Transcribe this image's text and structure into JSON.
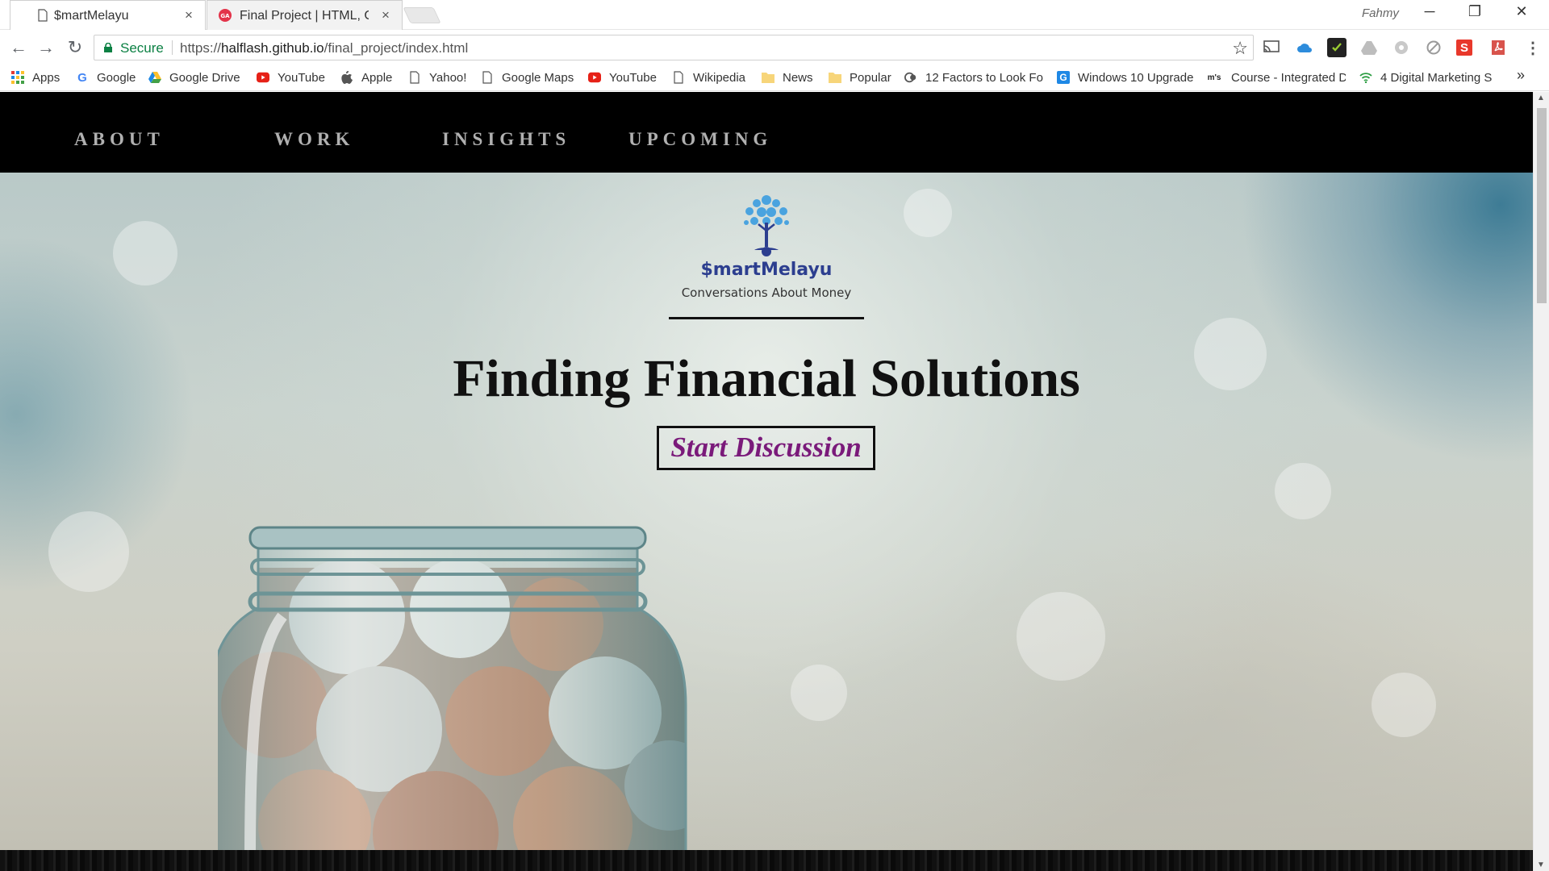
{
  "browser": {
    "tabs": [
      {
        "title": "$martMelayu",
        "close": "×",
        "active": true
      },
      {
        "title": "Final Project | HTML, CSS",
        "close": "×",
        "active": false
      }
    ],
    "profile_name": "Fahmy",
    "window_controls": {
      "minimize": "─",
      "restore": "❐",
      "close": "✕"
    },
    "nav": {
      "back": "←",
      "forward": "→",
      "reload": "↻"
    },
    "address": {
      "secure_label": "Secure",
      "url_prefix": "https://",
      "url_host": "halflash.github.io",
      "url_path": "/final_project/index.html",
      "star": "☆"
    },
    "extensions": [
      "cast-icon",
      "cloud-icon",
      "checkmark-extension-icon",
      "drive-icon",
      "lastpass-icon",
      "block-icon",
      "s-extension-icon",
      "pdf-icon",
      "menu-icon"
    ],
    "bookmarks": [
      {
        "label": "Apps",
        "icon": "apps-grid-icon"
      },
      {
        "label": "Google",
        "icon": "google-icon"
      },
      {
        "label": "Google Drive",
        "icon": "google-drive-icon"
      },
      {
        "label": "YouTube",
        "icon": "youtube-icon"
      },
      {
        "label": "Apple",
        "icon": "apple-icon"
      },
      {
        "label": "Yahoo!",
        "icon": "page-icon"
      },
      {
        "label": "Google Maps",
        "icon": "page-icon"
      },
      {
        "label": "YouTube",
        "icon": "youtube-icon"
      },
      {
        "label": "Wikipedia",
        "icon": "page-icon"
      },
      {
        "label": "News",
        "icon": "folder-icon"
      },
      {
        "label": "Popular",
        "icon": "folder-icon"
      },
      {
        "label": "12 Factors to Look Fo",
        "icon": "site-icon"
      },
      {
        "label": "Windows 10 Upgrade",
        "icon": "g-site-icon"
      },
      {
        "label": "Course - Integrated D",
        "icon": "mis-icon"
      },
      {
        "label": "4 Digital Marketing S",
        "icon": "wifi-icon"
      }
    ],
    "bookmarks_overflow": "»",
    "colors": {
      "secure": "#0b8043",
      "youtube": "#e62117"
    }
  },
  "site": {
    "nav": [
      "ABOUT",
      "WORK",
      "INSIGHTS",
      "UPCOMING"
    ],
    "brand": "$martMelayu",
    "tagline": "Conversations About Money",
    "headline": "Finding Financial Solutions",
    "cta": "Start Discussion",
    "colors": {
      "nav_bg": "#000000",
      "nav_text": "#b0b0b0",
      "brand": "#2c3e8f",
      "cta_text": "#7a1a7a",
      "logo_tree": "#4aa3df"
    }
  }
}
